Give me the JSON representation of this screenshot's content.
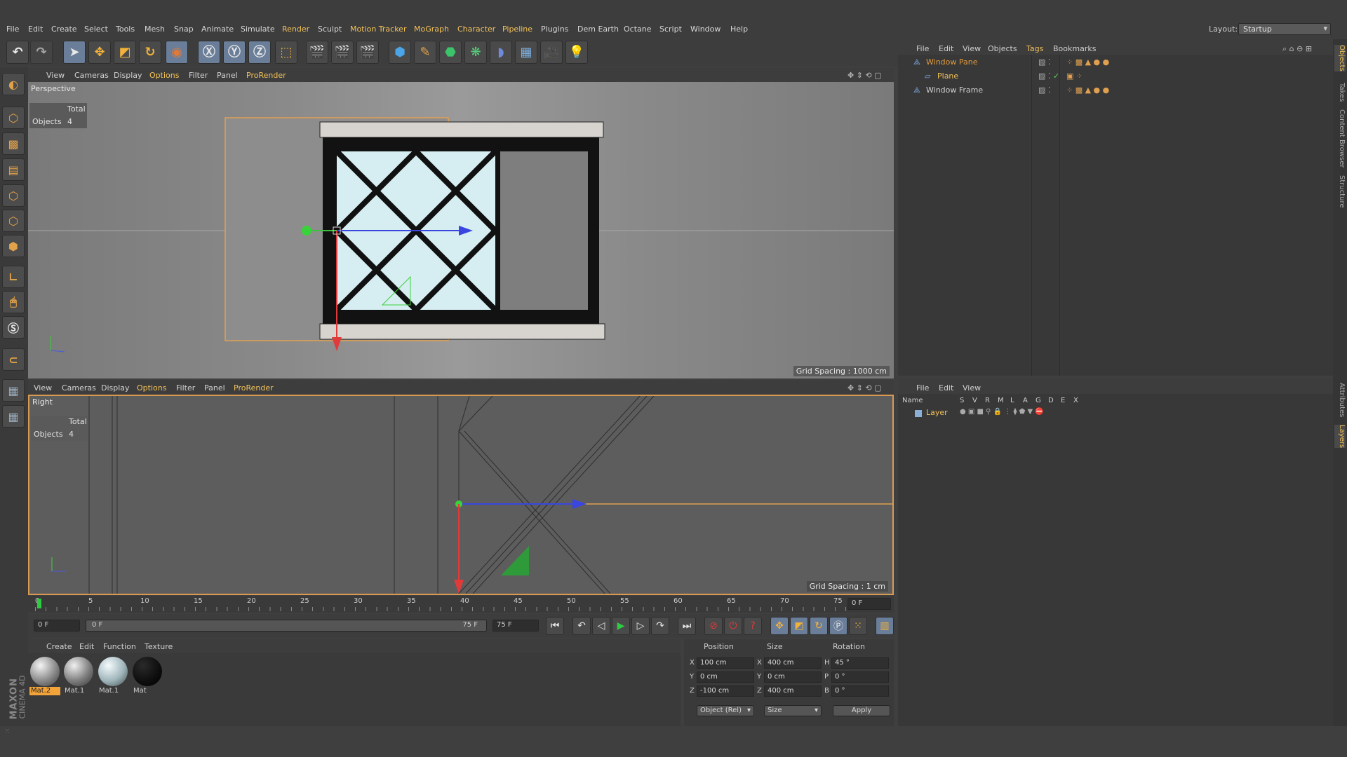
{
  "menu": {
    "items": [
      "File",
      "Edit",
      "Create",
      "Select",
      "Tools",
      "Mesh",
      "Snap",
      "Animate",
      "Simulate",
      "Render",
      "Sculpt",
      "Motion Tracker",
      "MoGraph",
      "Character",
      "Pipeline",
      "Plugins",
      "Dem Earth",
      "Octane",
      "Script",
      "Window",
      "Help"
    ],
    "layout_label": "Layout:",
    "layout_value": "Startup"
  },
  "viewport_menu": [
    "View",
    "Cameras",
    "Display",
    "Options",
    "Filter",
    "Panel",
    "ProRender"
  ],
  "viewport1": {
    "label": "Perspective",
    "hud_total": "Total",
    "hud_objects_label": "Objects",
    "hud_objects_count": "4",
    "grid_spacing": "Grid Spacing : 1000 cm"
  },
  "viewport2": {
    "label": "Right",
    "hud_total": "Total",
    "hud_objects_label": "Objects",
    "hud_objects_count": "4",
    "grid_spacing": "Grid Spacing : 1 cm"
  },
  "object_manager": {
    "menu": [
      "File",
      "Edit",
      "View",
      "Objects",
      "Tags",
      "Bookmarks"
    ],
    "objects": [
      {
        "name": "Window Pane",
        "color": "#e09a3e"
      },
      {
        "name": "Plane",
        "color": "#f3c25a"
      },
      {
        "name": "Window Frame",
        "color": "#d0d0d0"
      }
    ]
  },
  "layer_manager": {
    "menu": [
      "File",
      "Edit",
      "View"
    ],
    "header_name": "Name",
    "header_cols": [
      "S",
      "V",
      "R",
      "M",
      "L",
      "A",
      "G",
      "D",
      "E",
      "X"
    ],
    "layer_name": "Layer"
  },
  "side_tabs": [
    "Objects",
    "Takes",
    "Content Browser",
    "Structure",
    "Attributes",
    "Layers"
  ],
  "timeline": {
    "ticks": [
      "0",
      "5",
      "10",
      "15",
      "20",
      "25",
      "30",
      "35",
      "40",
      "45",
      "50",
      "55",
      "60",
      "65",
      "70",
      "75"
    ],
    "current_frame_right": "0 F",
    "start_field": "0 F",
    "range_start": "0 F",
    "range_end": "75 F",
    "end_field": "75 F"
  },
  "materials": {
    "menu": [
      "Create",
      "Edit",
      "Function",
      "Texture"
    ],
    "items": [
      {
        "name": "Mat.2",
        "selected": true
      },
      {
        "name": "Mat.1",
        "selected": false
      },
      {
        "name": "Mat.1",
        "selected": false
      },
      {
        "name": "Mat",
        "selected": false
      }
    ]
  },
  "coordinates": {
    "headers": [
      "Position",
      "Size",
      "Rotation"
    ],
    "rows": [
      {
        "axis": "X",
        "position": "100 cm",
        "size_axis": "X",
        "size": "400 cm",
        "rot_axis": "H",
        "rotation": "45 °"
      },
      {
        "axis": "Y",
        "position": "0 cm",
        "size_axis": "Y",
        "size": "0 cm",
        "rot_axis": "P",
        "rotation": "0 °"
      },
      {
        "axis": "Z",
        "position": "-100 cm",
        "size_axis": "Z",
        "size": "400 cm",
        "rot_axis": "B",
        "rotation": "0 °"
      }
    ],
    "mode": "Object (Rel)",
    "size_mode": "Size",
    "apply": "Apply"
  },
  "brand": {
    "maxon": "MAXON",
    "product": "CINEMA 4D"
  }
}
